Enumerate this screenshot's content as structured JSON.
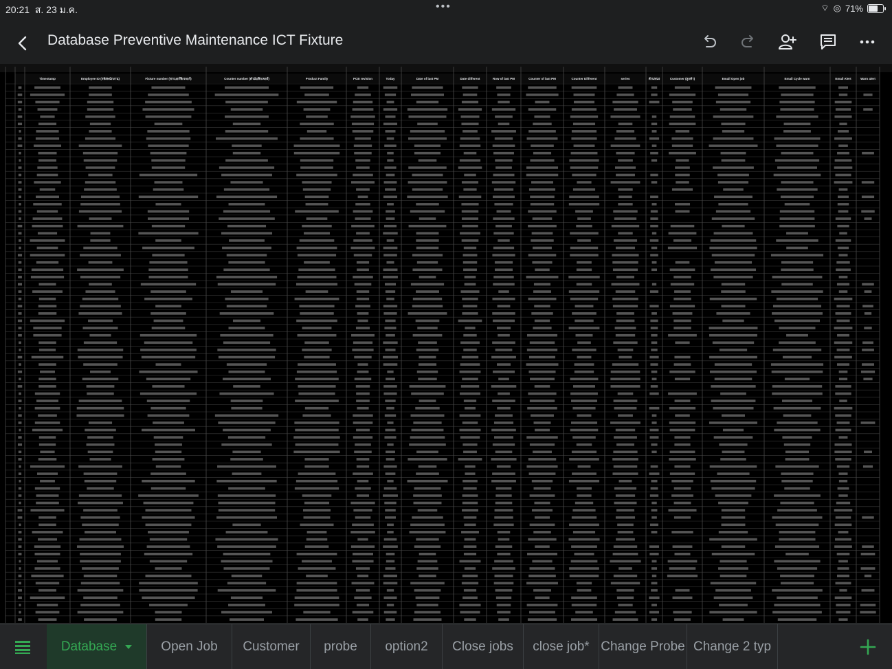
{
  "status_bar": {
    "time": "20:21",
    "date": "ส. 23 ม.ค.",
    "battery": "71%",
    "battery_level": 0.71
  },
  "document": {
    "title": "Database Preventive Maintenance ICT Fixture"
  },
  "toolbar": {
    "icons": [
      "back-icon",
      "undo-icon",
      "redo-icon",
      "share-icon",
      "comment-icon",
      "more-icon"
    ]
  },
  "sheet": {
    "headers": [
      "Timestamp",
      "Employee ID (รหัสพนักงาน)",
      "Fixture number (ขาเบอร์ฟิกเจอร์)",
      "Counter number (ตัวนับฟิกเจอร์)",
      "Product Family",
      "PCB revision",
      "Today",
      "Date of last PM",
      "Date different",
      "Row of last PM",
      "Counter of last PM",
      "Counter Different",
      "series",
      "ตำแหน่ง",
      "Customer (ลูกค้า)",
      "Email Open job",
      "Email Cycle warn",
      "Email Alert",
      "Warn alert"
    ],
    "row_count": 74
  },
  "tabs": [
    {
      "label": "Database",
      "active": true
    },
    {
      "label": "Open Job",
      "active": false
    },
    {
      "label": "Customer",
      "active": false
    },
    {
      "label": "probe",
      "active": false
    },
    {
      "label": "option2",
      "active": false
    },
    {
      "label": "Close jobs",
      "active": false
    },
    {
      "label": "close job*",
      "active": false
    },
    {
      "label": "Change Probe",
      "active": false
    },
    {
      "label": "Change 2 typ",
      "active": false
    }
  ],
  "colors": {
    "background": "#1e1f20",
    "sheet_background": "#000000",
    "accent_green": "#34a853",
    "icon": "#bdc1c6"
  }
}
